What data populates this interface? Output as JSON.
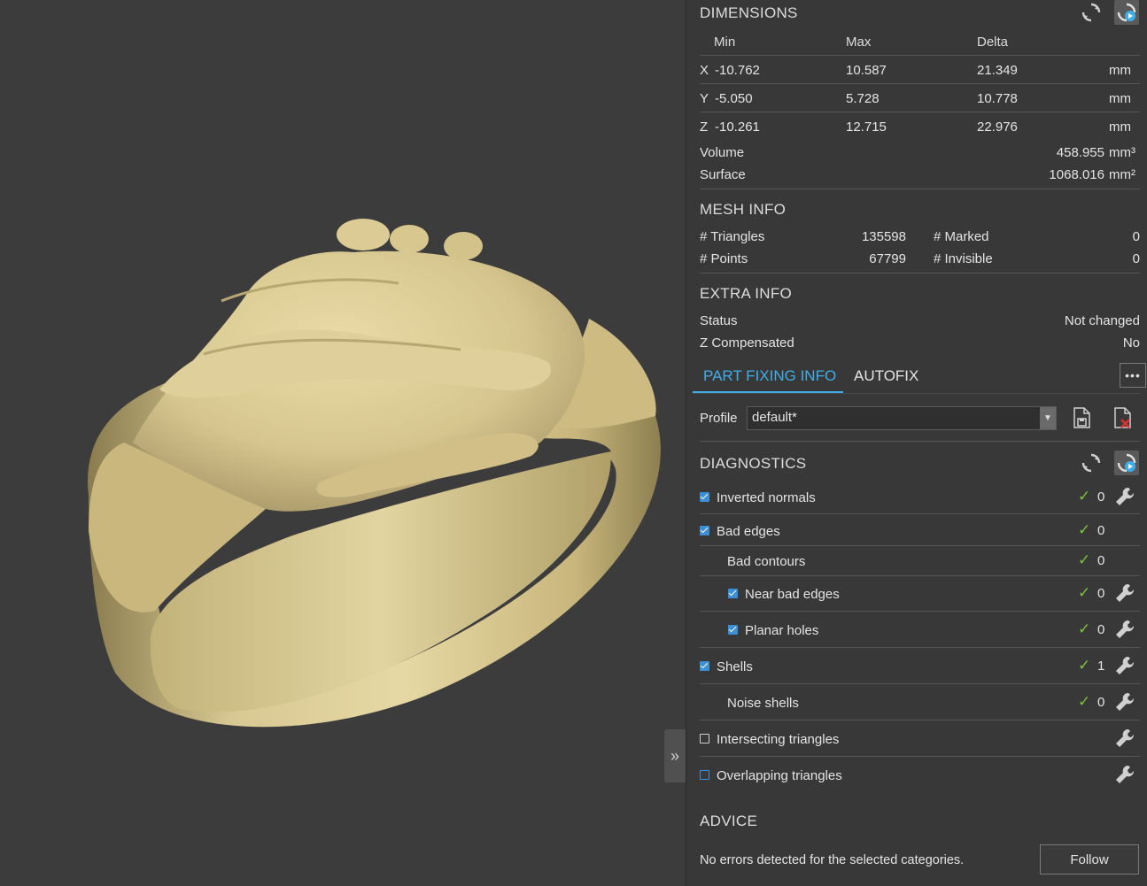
{
  "dimensions": {
    "title": "DIMENSIONS",
    "headers": {
      "min": "Min",
      "max": "Max",
      "delta": "Delta"
    },
    "rows": [
      {
        "axis": "X",
        "min": "-10.762",
        "max": "10.587",
        "delta": "21.349",
        "unit": "mm"
      },
      {
        "axis": "Y",
        "min": "-5.050",
        "max": "5.728",
        "delta": "10.778",
        "unit": "mm"
      },
      {
        "axis": "Z",
        "min": "-10.261",
        "max": "12.715",
        "delta": "22.976",
        "unit": "mm"
      }
    ],
    "volume_label": "Volume",
    "volume_value": "458.955",
    "volume_unit": "mm³",
    "surface_label": "Surface",
    "surface_value": "1068.016",
    "surface_unit": "mm²"
  },
  "mesh_info": {
    "title": "MESH INFO",
    "triangles_label": "# Triangles",
    "triangles_value": "135598",
    "points_label": "# Points",
    "points_value": "67799",
    "marked_label": "# Marked",
    "marked_value": "0",
    "invisible_label": "# Invisible",
    "invisible_value": "0"
  },
  "extra_info": {
    "title": "EXTRA INFO",
    "status_label": "Status",
    "status_value": "Not changed",
    "zcomp_label": "Z Compensated",
    "zcomp_value": "No"
  },
  "tabs": {
    "part_fixing": "PART FIXING INFO",
    "autofix": "AUTOFIX",
    "more": "•••"
  },
  "profile": {
    "label": "Profile",
    "value": "default*"
  },
  "diagnostics": {
    "title": "DIAGNOSTICS",
    "items": [
      {
        "label": "Inverted normals",
        "count": "0"
      },
      {
        "label": "Bad edges",
        "count": "0"
      },
      {
        "label": "Bad contours",
        "count": "0"
      },
      {
        "label": "Near bad edges",
        "count": "0"
      },
      {
        "label": "Planar holes",
        "count": "0"
      },
      {
        "label": "Shells",
        "count": "1"
      },
      {
        "label": "Noise shells",
        "count": "0"
      },
      {
        "label": "Intersecting triangles",
        "count": ""
      },
      {
        "label": "Overlapping triangles",
        "count": ""
      }
    ]
  },
  "advice": {
    "title": "ADVICE",
    "message": "No errors detected for the selected categories.",
    "follow_label": "Follow"
  },
  "viewport": {
    "collapse_glyph": "»"
  },
  "colors": {
    "accent": "#3daee9",
    "ok_check": "#7cc242",
    "model_gold": "#d9c88f",
    "background": "#3c3c3c"
  }
}
